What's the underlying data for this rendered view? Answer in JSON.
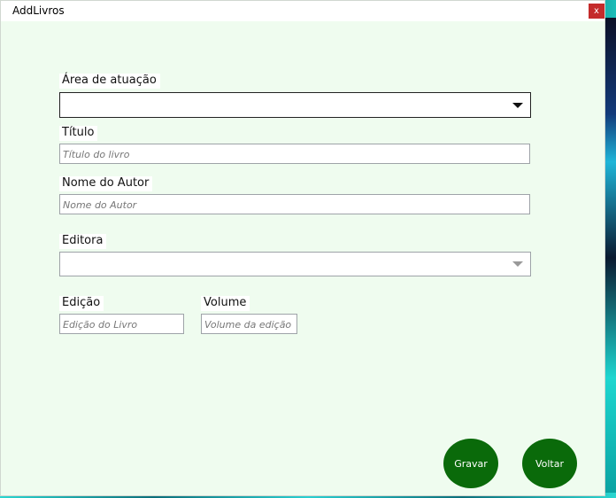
{
  "window": {
    "title": "AddLivros",
    "close_label": "x"
  },
  "form": {
    "area": {
      "label": "Área de atuação",
      "value": ""
    },
    "titulo": {
      "label": "Título",
      "placeholder": "Título do livro"
    },
    "autor": {
      "label": "Nome do Autor",
      "placeholder": "Nome do Autor"
    },
    "editora": {
      "label": "Editora",
      "value": ""
    },
    "edicao": {
      "label": "Edição",
      "placeholder": "Edição do Livro"
    },
    "volume": {
      "label": "Volume",
      "placeholder": "Volume da edição"
    }
  },
  "buttons": {
    "gravar": "Gravar",
    "voltar": "Voltar"
  },
  "colors": {
    "window_bg": "#effcef",
    "button_bg": "#0a6a0a",
    "close_bg": "#c42b2b"
  }
}
